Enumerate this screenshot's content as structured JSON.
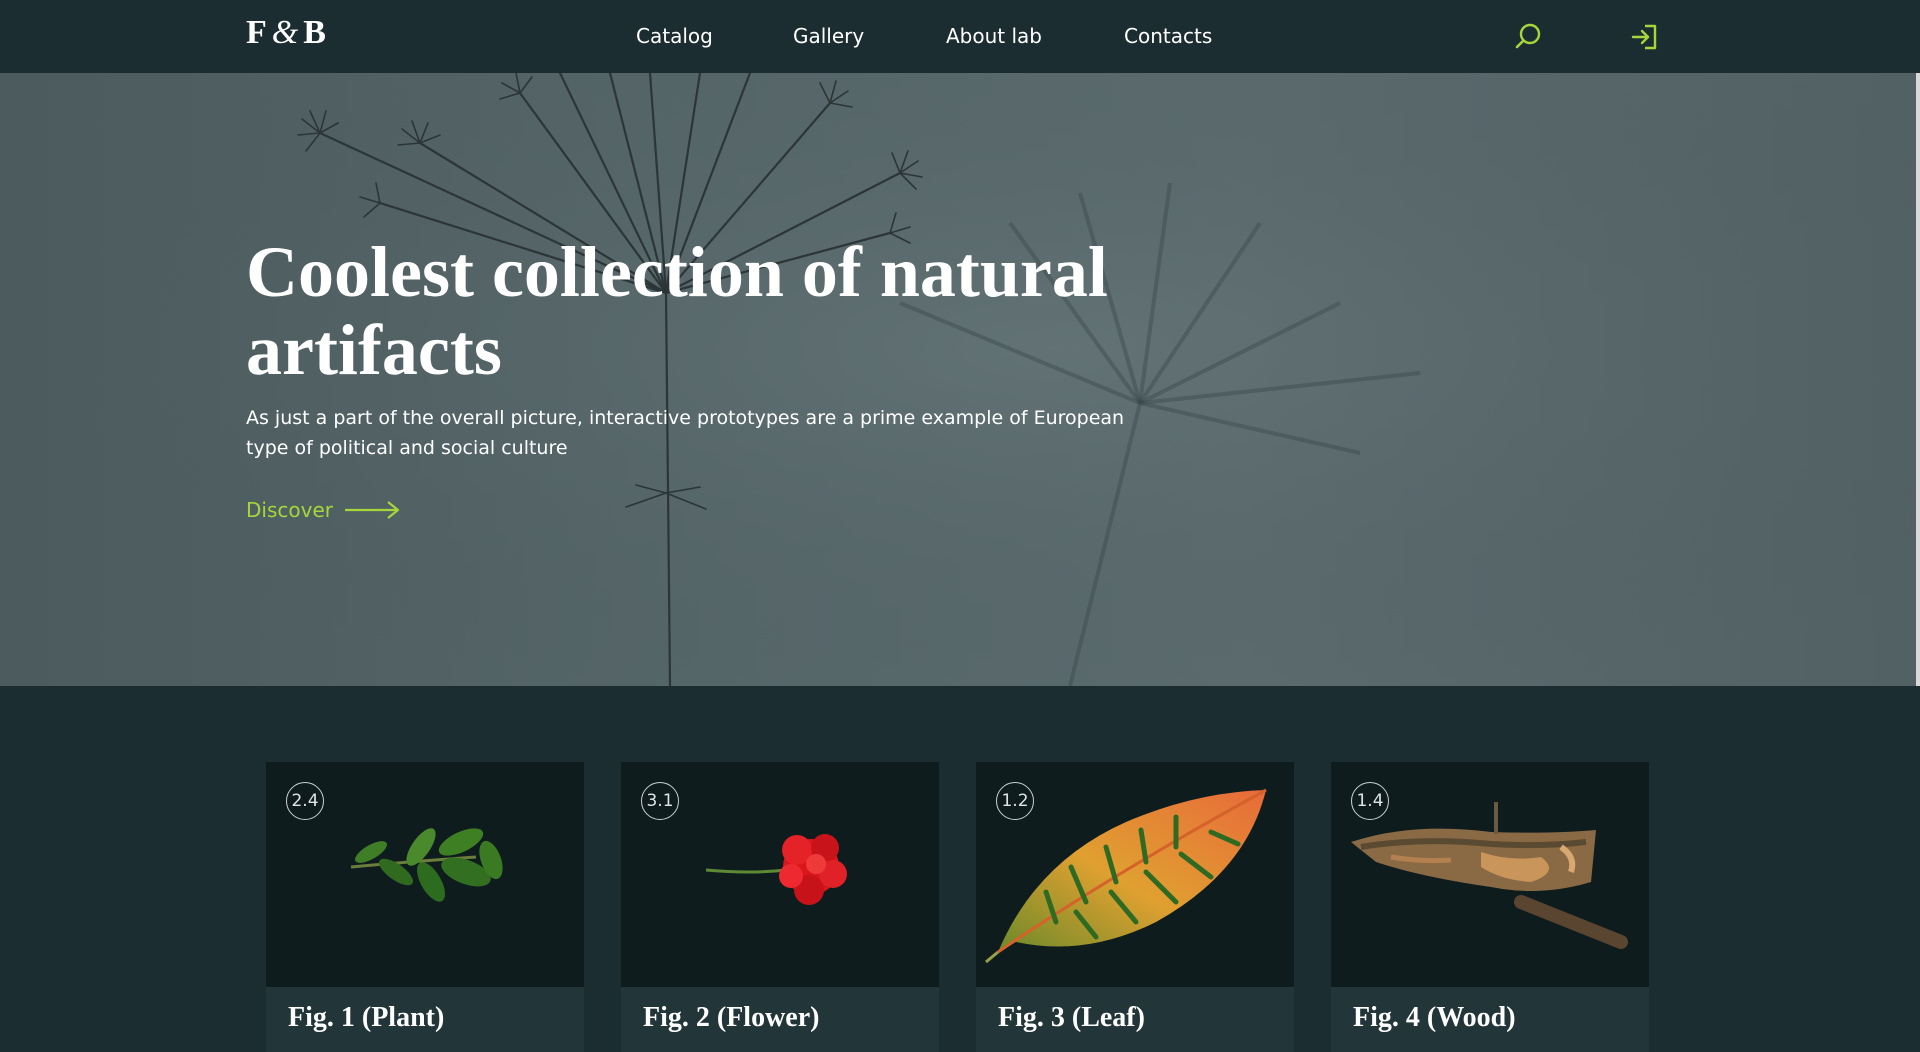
{
  "header": {
    "logo_left": "F",
    "logo_amp": "&",
    "logo_right": "B",
    "nav": [
      {
        "label": "Catalog"
      },
      {
        "label": "Gallery"
      },
      {
        "label": "About lab"
      },
      {
        "label": "Contacts"
      }
    ],
    "search_icon": "search-icon",
    "login_icon": "login-icon"
  },
  "hero": {
    "title": "Coolest collection of natural artifacts",
    "description": "As just a part of the overall picture, interactive prototypes are a prime example of European type of political and social culture",
    "cta_label": "Discover"
  },
  "cards": [
    {
      "badge": "2.4",
      "title": "Fig. 1 (Plant)",
      "image": "plant-sprig"
    },
    {
      "badge": "3.1",
      "title": "Fig. 2 (Flower)",
      "image": "red-carnation"
    },
    {
      "badge": "1.2",
      "title": "Fig. 3 (Leaf)",
      "image": "croton-leaf"
    },
    {
      "badge": "1.4",
      "title": "Fig. 4 (Wood)",
      "image": "wood-bark"
    }
  ],
  "colors": {
    "background": "#1c2d31",
    "accent": "#a6d63c",
    "card_media": "#0f1c1e",
    "card_body": "#223539"
  }
}
